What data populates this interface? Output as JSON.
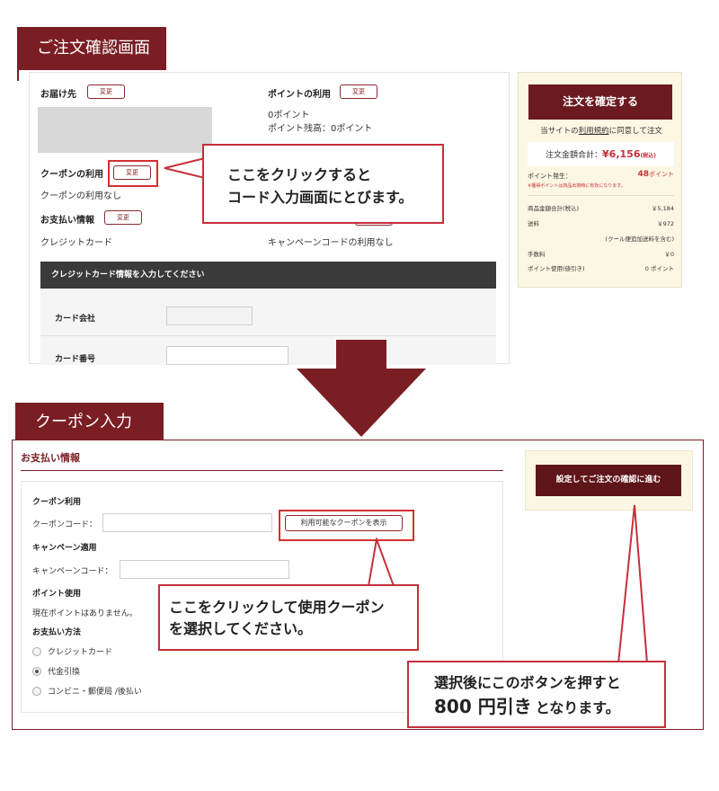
{
  "top": {
    "tab_title": "ご注文確認画面",
    "delivery_label": "お届け先",
    "change_label": "変更",
    "points_label": "ポイントの利用",
    "points_value": "0ポイント",
    "points_balance": "ポイント残高：0ポイント",
    "coupon_label": "クーポンの利用",
    "coupon_value": "クーポンの利用なし",
    "payment_label": "お支払い情報",
    "payment_value": "クレジットカード",
    "campaign_value": "キャンペーンコードの利用なし",
    "card_panel_title": "クレジットカード情報を入力してください",
    "card_company_label": "カード会社",
    "card_number_label": "カード番号",
    "callout_line1": "ここをクリックすると",
    "callout_line2": "コード入力画面にとびます。"
  },
  "summary": {
    "confirm_button": "注文を確定する",
    "agree_prefix": "当サイトの",
    "agree_link": "利用規約",
    "agree_suffix": "に同意して注文",
    "total_label": "注文金額合計：",
    "total_value": "¥6,156",
    "total_tax": "(税込)",
    "points_label": "ポイント発生：",
    "points_value": "48",
    "points_unit": "ポイント",
    "points_note": "※獲得ポイントは商品出荷時に有効になります。",
    "rows": [
      {
        "label": "商品金額合計(税込)",
        "value": "￥5,184"
      },
      {
        "label": "送料",
        "value": "￥972"
      },
      {
        "label": "",
        "value": "(クール便追加送料を含む)"
      },
      {
        "label": "手数料",
        "value": "￥0"
      },
      {
        "label": "ポイント使用(値引き)",
        "value": "0 ポイント"
      }
    ]
  },
  "bottom": {
    "tab_title": "クーポン入力",
    "section_title": "お支払い情報",
    "coupon_heading": "クーポン利用",
    "coupon_code_label": "クーポンコード：",
    "show_coupons_button": "利用可能なクーポンを表示",
    "campaign_heading": "キャンペーン適用",
    "campaign_code_label": "キャンペーンコード：",
    "points_heading": "ポイント使用",
    "points_text": "現在ポイントはありません。",
    "payment_heading": "お支払い方法",
    "payment_options": [
      "クレジットカード",
      "代金引換",
      "コンビニ・郵便局 /後払い"
    ],
    "submit_button": "設定してご注文の確認に進む",
    "callout1_line1": "ここをクリックして使用クーポン",
    "callout1_line2": "を選択してください。",
    "callout2_line1": "選択後にこのボタンを押すと",
    "callout2_big": "800 円引き",
    "callout2_rest": "となります。"
  },
  "colors": {
    "brand": "#7a1e24",
    "accent": "#c6303a",
    "summary_bg": "#fcf7e3"
  }
}
